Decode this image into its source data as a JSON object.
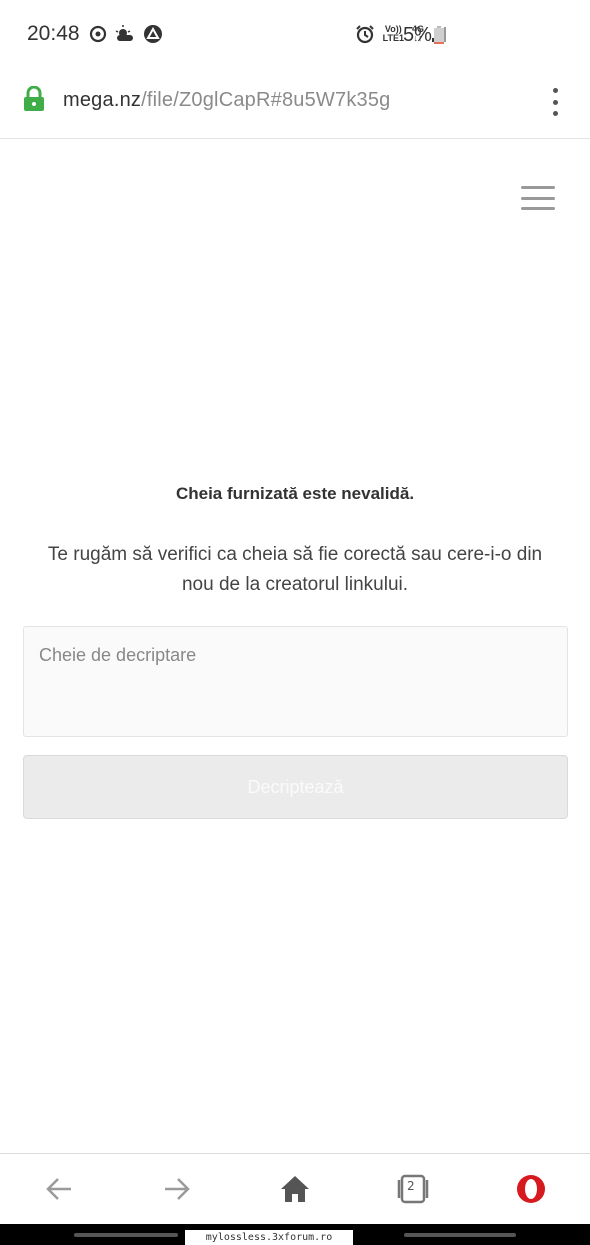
{
  "status_bar": {
    "time": "20:48",
    "left_icons": [
      "sync-icon",
      "weather-icon",
      "app-icon"
    ],
    "network_top": "Vo))",
    "network_bottom": "LTE1",
    "network_type": "4G",
    "battery_percent": "5%",
    "battery_color": "#e8705a"
  },
  "address_bar": {
    "host": "mega.nz",
    "path": "/file/Z0glCapR#8u5W7k35g",
    "lock_color": "#3fae49"
  },
  "page": {
    "error_title": "Cheia furnizată este nevalidă.",
    "error_message": "Te rugăm să verifici ca cheia să fie corectă sau cere-i-o din nou de la creatorul linkului.",
    "key_input": {
      "value": "",
      "placeholder": "Cheie de decriptare"
    },
    "decrypt_button": "Decriptează"
  },
  "bottom_nav": {
    "tab_count": "2",
    "items": [
      "back-icon",
      "forward-icon",
      "home-icon",
      "tabs-icon",
      "opera-icon"
    ]
  },
  "watermark": "mylossless.3xforum.ro"
}
